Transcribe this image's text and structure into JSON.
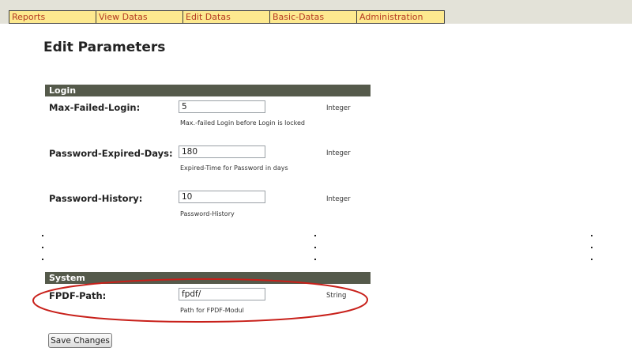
{
  "nav": {
    "items": [
      "Reports",
      "View Datas",
      "Edit Datas",
      "Basic-Datas",
      "Administration"
    ]
  },
  "page": {
    "title": "Edit Parameters"
  },
  "sections": {
    "login": {
      "header": "Login",
      "rows": [
        {
          "label": "Max-Failed-Login:",
          "value": "5",
          "help": "Max.-failed Login before Login is locked",
          "type": "Integer"
        },
        {
          "label": "Password-Expired-Days:",
          "value": "180",
          "help": "Expired-Time for Password in days",
          "type": "Integer"
        },
        {
          "label": "Password-History:",
          "value": "10",
          "help": "Password-History",
          "type": "Integer"
        }
      ]
    },
    "system": {
      "header": "System",
      "rows": [
        {
          "label": "FPDF-Path:",
          "value": "fpdf/",
          "help": "Path for FPDF-Modul",
          "type": "String"
        }
      ]
    }
  },
  "actions": {
    "save_label": "Save Changes"
  },
  "colors": {
    "nav_background": "#fde98f",
    "nav_text": "#b53a22",
    "section_header": "#555a4b",
    "annotation_ellipse": "#c8201a"
  }
}
